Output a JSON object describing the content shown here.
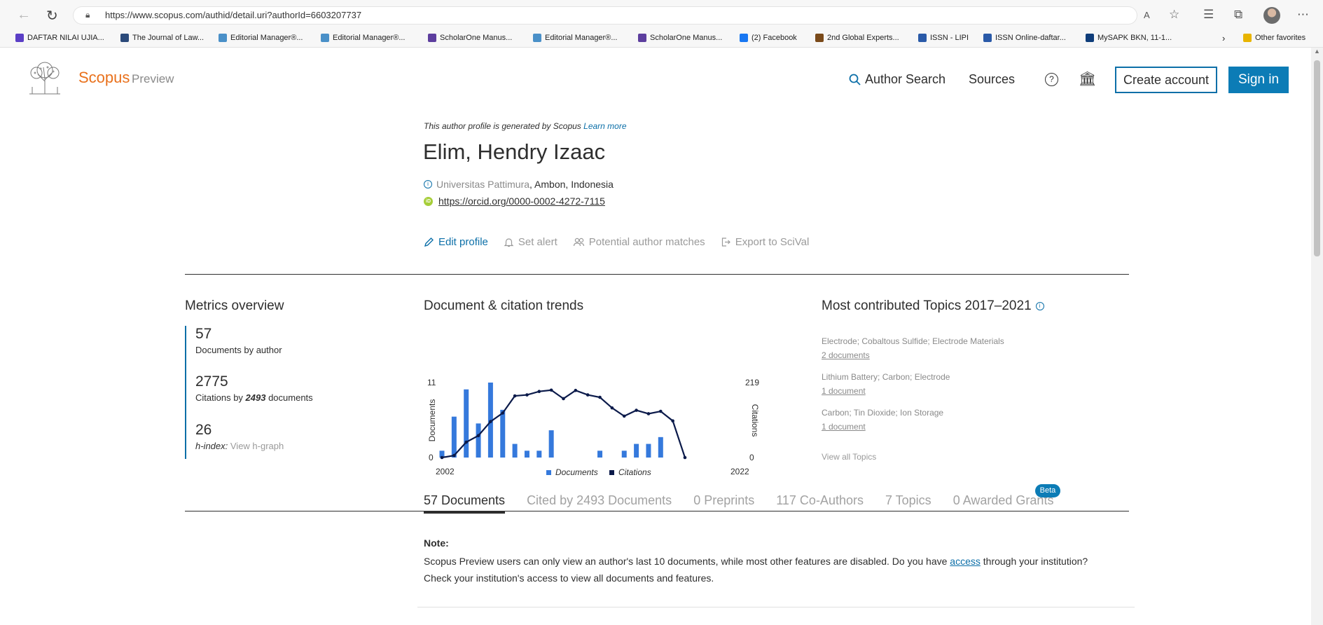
{
  "browser": {
    "url": "https://www.scopus.com/authid/detail.uri?authorId=6603207737",
    "icons": [
      "back-icon",
      "refresh-icon",
      "lock-icon",
      "read-aloud-icon",
      "favorite-icon",
      "favorites-icon",
      "collections-icon",
      "more-icon"
    ],
    "bookmarks": [
      {
        "label": "DAFTAR NILAI UJIA...",
        "icon_color": "#5b3fc6"
      },
      {
        "label": "The Journal of Law...",
        "icon_color": "#2b4a7a"
      },
      {
        "label": "Editorial Manager®...",
        "icon_color": "#4a90c8"
      },
      {
        "label": "Editorial Manager®...",
        "icon_color": "#4a90c8"
      },
      {
        "label": "ScholarOne Manus...",
        "icon_color": "#5d3e9e"
      },
      {
        "label": "Editorial Manager®...",
        "icon_color": "#4a90c8"
      },
      {
        "label": "ScholarOne Manus...",
        "icon_color": "#5d3e9e"
      },
      {
        "label": "(2) Facebook",
        "icon_color": "#1877f2"
      },
      {
        "label": "2nd Global Experts...",
        "icon_color": "#7a4a1a"
      },
      {
        "label": "ISSN - LIPI",
        "icon_color": "#2a5aa8"
      },
      {
        "label": "ISSN Online-daftar...",
        "icon_color": "#2a5aa8"
      },
      {
        "label": "MySAPK BKN, 11-1...",
        "icon_color": "#0f3d7a"
      }
    ],
    "other_favorites": "Other favorites"
  },
  "header": {
    "brand": "Scopus",
    "brand_suffix": "Preview",
    "author_search": "Author Search",
    "sources": "Sources",
    "create_account": "Create account",
    "sign_in": "Sign in",
    "accent_color": "#e9711c",
    "primary_color": "#0c7cb6"
  },
  "profile": {
    "note": "This author profile is generated by Scopus",
    "learn_more": "Learn more",
    "name": "Elim, Hendry Izaac",
    "affiliation": "Universitas Pattimura",
    "location": ", Ambon, Indonesia",
    "orcid": "https://orcid.org/0000-0002-4272-7115",
    "actions": {
      "edit_profile": "Edit profile",
      "set_alert": "Set alert",
      "potential_matches": "Potential author matches",
      "export": "Export to SciVal"
    }
  },
  "metrics": {
    "title": "Metrics overview",
    "documents_value": "57",
    "documents_label": "Documents by author",
    "citations_value": "2775",
    "citations_label_prefix": "Citations by ",
    "citations_label_count": "2493",
    "citations_label_suffix": " documents",
    "hindex_value": "26",
    "hindex_label": "h-index:",
    "hindex_link": "View h-graph"
  },
  "trends": {
    "title": "Document & citation trends"
  },
  "chart_data": {
    "type": "bar",
    "years": [
      2002,
      2003,
      2004,
      2005,
      2006,
      2007,
      2008,
      2009,
      2010,
      2011,
      2012,
      2013,
      2014,
      2015,
      2016,
      2017,
      2018,
      2019,
      2020,
      2021,
      2022
    ],
    "series": [
      {
        "name": "Documents",
        "type": "bar",
        "axis": "left",
        "color": "#3579dc",
        "values": [
          1,
          6,
          10,
          5,
          11,
          7,
          2,
          1,
          1,
          4,
          0,
          0,
          0,
          1,
          0,
          1,
          2,
          2,
          3,
          0,
          0
        ]
      },
      {
        "name": "Citations",
        "type": "line",
        "axis": "right",
        "color": "#0b1a4a",
        "values": [
          0,
          6,
          45,
          64,
          105,
          130,
          180,
          183,
          193,
          197,
          172,
          196,
          183,
          176,
          145,
          121,
          138,
          128,
          135,
          107,
          0
        ]
      }
    ],
    "left_axis": {
      "label": "Documents",
      "min": "0",
      "max": "11",
      "range": [
        0,
        11
      ]
    },
    "right_axis": {
      "label": "Citations",
      "min": "0",
      "max": "219",
      "range": [
        0,
        219
      ]
    },
    "x_start_label": "2002",
    "x_end_label": "2022",
    "legend": "bottom-center",
    "grid": false
  },
  "topics": {
    "title": "Most contributed Topics 2017–2021",
    "items": [
      {
        "name": "Electrode; Cobaltous Sulfide; Electrode Materials",
        "count": "2 documents"
      },
      {
        "name": "Lithium Battery; Carbon; Electrode",
        "count": "1 document"
      },
      {
        "name": "Carbon; Tin Dioxide; Ion Storage",
        "count": "1 document"
      }
    ],
    "view_all": "View all Topics"
  },
  "tabs": {
    "items": [
      "57 Documents",
      "Cited by 2493 Documents",
      "0 Preprints",
      "117 Co-Authors",
      "7 Topics",
      "0 Awarded Grants"
    ],
    "active": 0,
    "beta": "Beta"
  },
  "note": {
    "heading": "Note:",
    "line1_before": "Scopus Preview users can only view an author's last 10 documents, while most other features are disabled. Do you have ",
    "line1_link": "access",
    "line1_after": " through your institution?",
    "line2": "Check your institution's access to view all documents and features."
  }
}
